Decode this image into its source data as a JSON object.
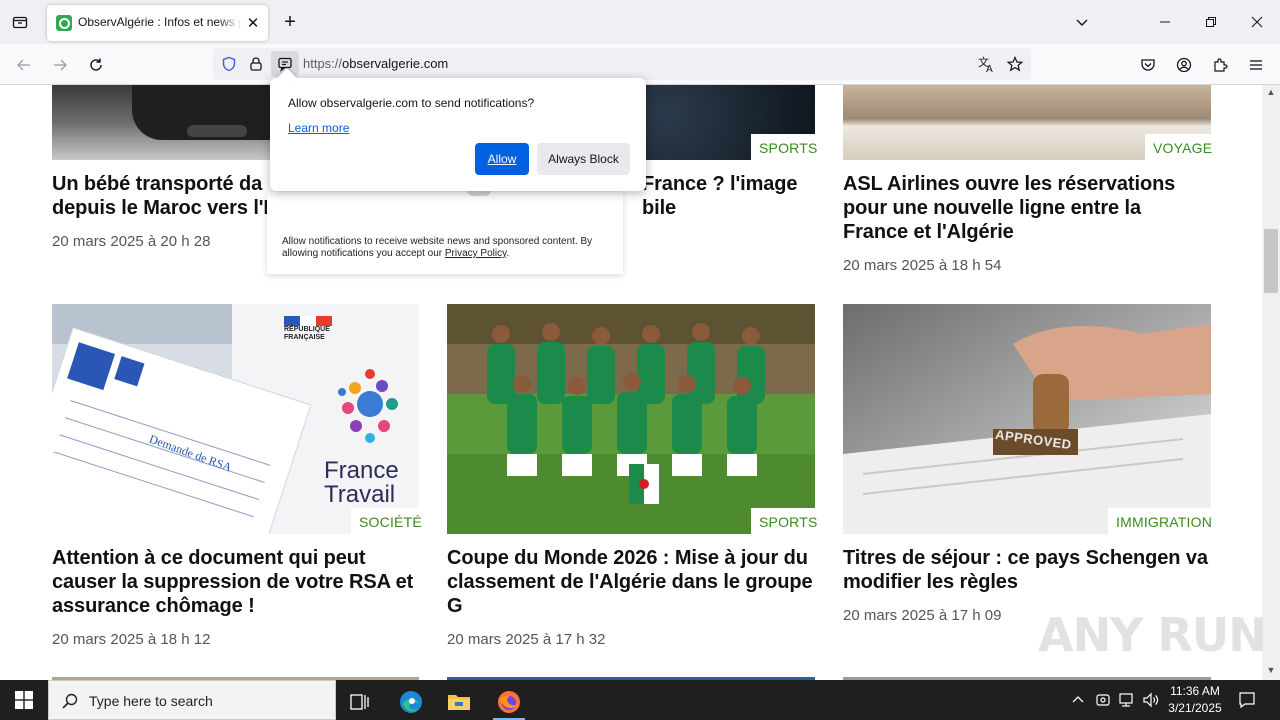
{
  "browser": {
    "tab": {
      "title": "ObservAlgérie : Infos et news pour tous"
    },
    "url": {
      "scheme": "https://",
      "host": "observalgerie.com"
    }
  },
  "popup": {
    "message": "Allow observalgerie.com to send notifications?",
    "learn_more": "Learn more",
    "allow_label": "Allow",
    "block_label": "Always Block"
  },
  "site_note": {
    "text": "Allow notifications to receive website news and sponsored content. By allowing notifications you accept our",
    "link": "Privacy Policy",
    "end": "."
  },
  "articles_top": [
    {
      "headline_line1": "Un bébé transporté da",
      "headline_line2": "depuis le Maroc vers l'I",
      "date": "20 mars 2025 à 20 h 28"
    },
    {
      "category": "SPORTS",
      "headline_line1": "France ? l'image",
      "headline_line2": "bile"
    },
    {
      "category": "VOYAGE",
      "headline": "ASL Airlines ouvre les réservations pour une nouvelle ligne entre la France et l'Algérie",
      "date": "20 mars 2025 à 18 h 54"
    }
  ],
  "articles": [
    {
      "category": "SOCIÉTÉ",
      "headline": "Attention à ce document qui peut causer la suppression de votre RSA et assurance chômage !",
      "date": "20 mars 2025 à 18 h 12",
      "image_text": {
        "rep": "RÉPUBLIQUE FRANÇAISE",
        "form": "Demande de RSA",
        "brand1": "France",
        "brand2": "Travail"
      }
    },
    {
      "category": "SPORTS",
      "headline": "Coupe du Monde 2026 : Mise à jour du classement de l'Algérie dans le groupe G",
      "date": "20 mars 2025 à 17 h 32"
    },
    {
      "category": "IMMIGRATION",
      "headline": "Titres de séjour : ce pays Schengen va modifier les règles",
      "date": "20 mars 2025 à 17 h 09",
      "image_text": {
        "stamp": "APPROVED"
      }
    }
  ],
  "watermark": "ANY RUN",
  "taskbar": {
    "search_placeholder": "Type here to search",
    "time": "11:36 AM",
    "date": "3/21/2025"
  }
}
